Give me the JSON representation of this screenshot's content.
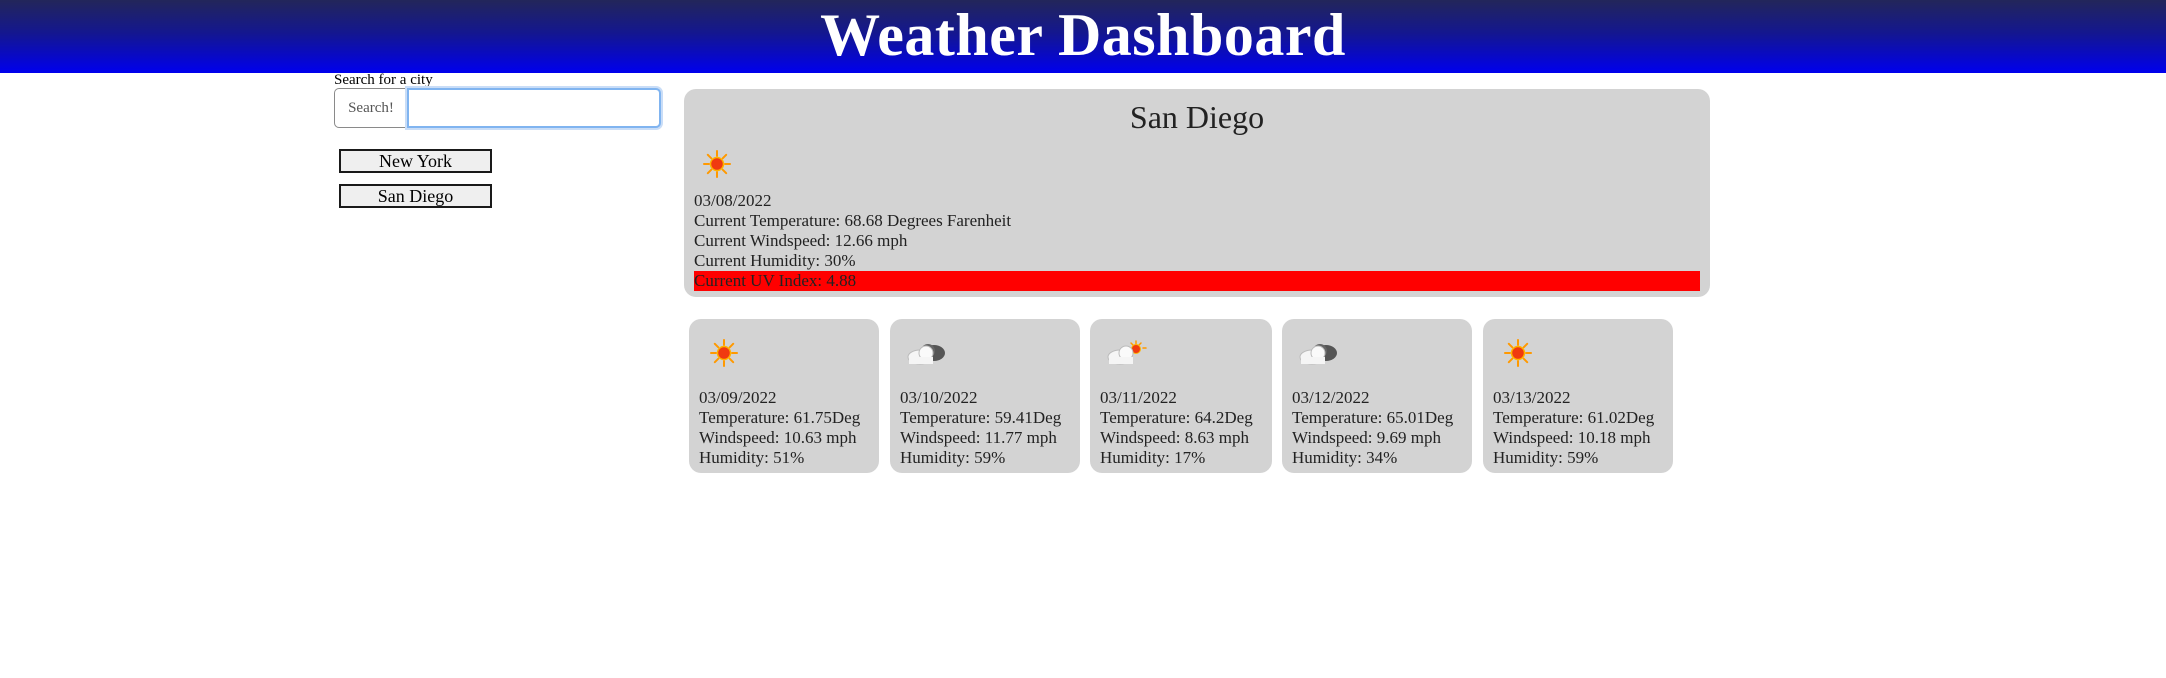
{
  "header": {
    "title": "Weather Dashboard"
  },
  "search": {
    "label": "Search for a city",
    "button_label": "Search!",
    "input_value": "",
    "placeholder": ""
  },
  "history": [
    {
      "label": "New York"
    },
    {
      "label": "San Diego"
    }
  ],
  "current": {
    "city": "San Diego",
    "icon": "sun-icon",
    "date": "03/08/2022",
    "temperature": "Current Temperature: 68.68 Degrees Farenheit",
    "windspeed": "Current Windspeed: 12.66 mph",
    "humidity": "Current Humidity: 30%",
    "uv": "Current UV Index: 4.88",
    "uv_color": "#ff0000"
  },
  "forecast": [
    {
      "icon": "sun-icon",
      "date": "03/09/2022",
      "temperature": "Temperature: 61.75Deg",
      "windspeed": "Windspeed: 10.63 mph",
      "humidity": "Humidity: 51%"
    },
    {
      "icon": "cloud-icon",
      "date": "03/10/2022",
      "temperature": "Temperature: 59.41Deg",
      "windspeed": "Windspeed: 11.77 mph",
      "humidity": "Humidity: 59%"
    },
    {
      "icon": "partly-cloudy-icon",
      "date": "03/11/2022",
      "temperature": "Temperature: 64.2Deg",
      "windspeed": "Windspeed: 8.63 mph",
      "humidity": "Humidity: 17%"
    },
    {
      "icon": "cloud-icon",
      "date": "03/12/2022",
      "temperature": "Temperature: 65.01Deg",
      "windspeed": "Windspeed: 9.69 mph",
      "humidity": "Humidity: 34%"
    },
    {
      "icon": "sun-icon",
      "date": "03/13/2022",
      "temperature": "Temperature: 61.02Deg",
      "windspeed": "Windspeed: 10.18 mph",
      "humidity": "Humidity: 59%"
    }
  ],
  "colors": {
    "header_top": "#23265a",
    "header_bottom": "#0000ee",
    "panel": "#d3d3d3",
    "uv_high": "#ff0000"
  }
}
